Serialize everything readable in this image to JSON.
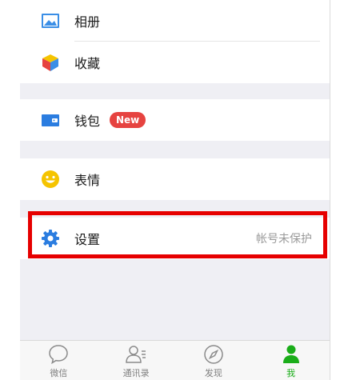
{
  "menu": {
    "album": {
      "label": "相册",
      "icon": "album-icon"
    },
    "favorites": {
      "label": "收藏",
      "icon": "favorites-cube-icon"
    },
    "wallet": {
      "label": "钱包",
      "badge": "New",
      "icon": "wallet-icon"
    },
    "stickers": {
      "label": "表情",
      "icon": "smiley-icon"
    },
    "settings": {
      "label": "设置",
      "note": "帐号未保护",
      "icon": "gear-icon"
    }
  },
  "tabbar": {
    "items": [
      {
        "label": "微信",
        "icon": "chat-bubble-icon"
      },
      {
        "label": "通讯录",
        "icon": "contacts-icon"
      },
      {
        "label": "发现",
        "icon": "compass-icon"
      },
      {
        "label": "我",
        "icon": "me-icon",
        "active": true
      }
    ]
  },
  "colors": {
    "accent_green": "#1aad19",
    "badge_red": "#e64340",
    "highlight_red": "#e60000",
    "album_blue": "#3a8ee6",
    "gear_blue": "#2b7de0",
    "smiley_yellow": "#f5c400"
  }
}
